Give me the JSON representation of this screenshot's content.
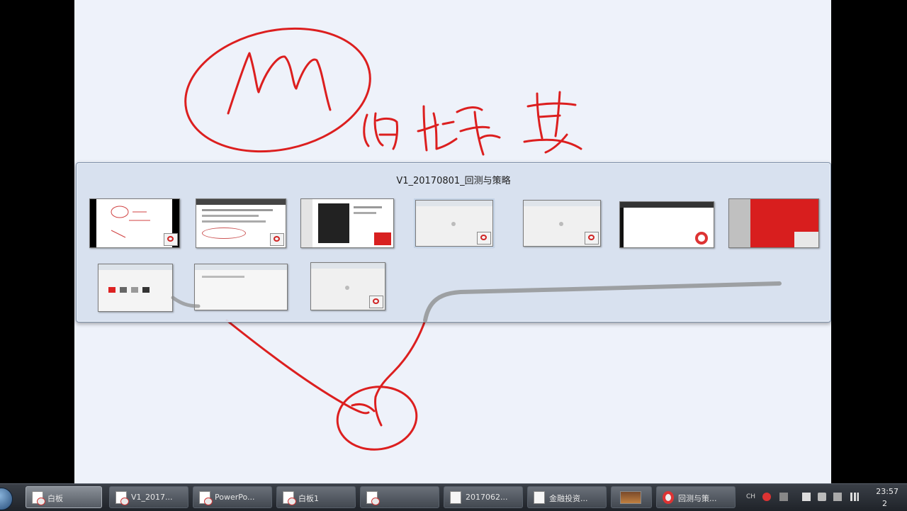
{
  "switcher": {
    "title": "V1_20170801_回测与策略",
    "windows": [
      "whiteboard-1",
      "browser-doc",
      "powerpoint",
      "window-blank-1",
      "window-blank-2",
      "browser-chrome",
      "red-slide",
      "explorer",
      "editor",
      "window-blank-3"
    ]
  },
  "handwriting": {
    "circled_letter": "M",
    "annotation": "M 的 地 址 / 坐 标"
  },
  "taskbar": {
    "tasks": [
      {
        "label": "白板",
        "icon": "whiteboard-icon"
      },
      {
        "label": "V1_2017...",
        "icon": "powerpoint-icon"
      },
      {
        "label": "PowerPo...",
        "icon": "powerpoint-icon"
      },
      {
        "label": "白板1",
        "icon": "whiteboard-icon"
      },
      {
        "label": "",
        "icon": "app-icon"
      },
      {
        "label": "2017062...",
        "icon": "document-icon"
      },
      {
        "label": "金融投资...",
        "icon": "document-icon"
      },
      {
        "label": "",
        "icon": "stack-icon"
      },
      {
        "label": "回测与策...",
        "icon": "chrome-icon"
      }
    ],
    "tray": {
      "language": "CH",
      "time": "23:57",
      "date": "2"
    }
  }
}
